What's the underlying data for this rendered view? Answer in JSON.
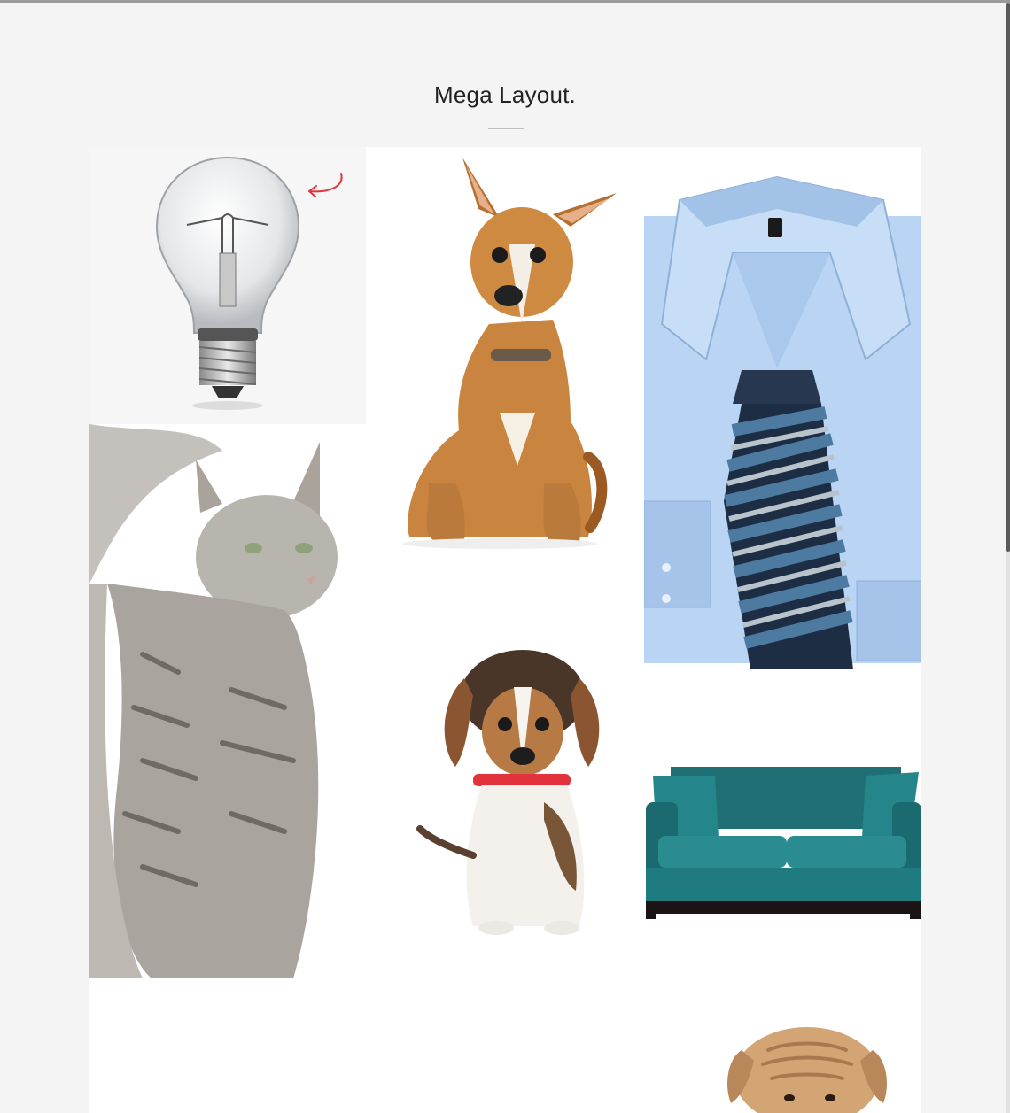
{
  "section": {
    "title": "Mega Layout."
  },
  "gallery": {
    "items": [
      {
        "name": "lightbulb",
        "icon": "lightbulb-image"
      },
      {
        "name": "chihuahua",
        "icon": "dog-image"
      },
      {
        "name": "shirt-and-tie",
        "icon": "shirt-image"
      },
      {
        "name": "cat",
        "icon": "cat-image"
      },
      {
        "name": "beagle",
        "icon": "puppy-image"
      },
      {
        "name": "sofa",
        "icon": "sofa-image"
      },
      {
        "name": "shar-pei",
        "icon": "sharpei-image"
      }
    ]
  },
  "colors": {
    "background": "#f4f4f4",
    "grid": "#ffffff",
    "shirt": "#b9d5f3",
    "sofa": "#1f7b80",
    "dog": "#c9843f",
    "arrow": "#e2333c"
  }
}
